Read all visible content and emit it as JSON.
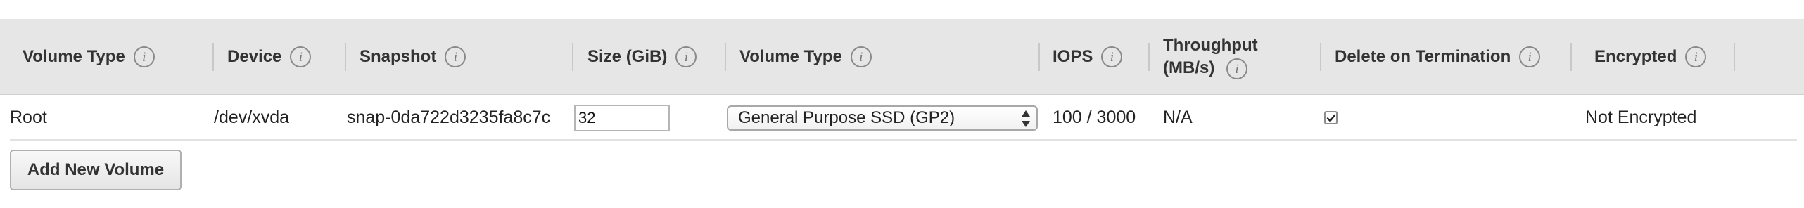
{
  "columns": [
    {
      "label": "Volume Type"
    },
    {
      "label": "Device"
    },
    {
      "label": "Snapshot"
    },
    {
      "label": "Size (GiB)"
    },
    {
      "label": "Volume Type"
    },
    {
      "label": "IOPS"
    },
    {
      "label": "Throughput (MB/s)"
    },
    {
      "label": "Delete on Termination"
    },
    {
      "label": "Encrypted"
    }
  ],
  "info_icon": {
    "glyph": "i",
    "name": "info-icon"
  },
  "row": {
    "volume_type": "Root",
    "device": "/dev/xvda",
    "snapshot": "snap-0da722d3235fa8c7c",
    "size_value": "32",
    "ebs_volume_type": "General Purpose SSD (GP2)",
    "iops": "100 / 3000",
    "throughput": "N/A",
    "delete_on_termination": true,
    "encrypted": "Not Encrypted"
  },
  "add_button_label": "Add New Volume",
  "colors": {
    "header_bg": "#e6e6e6",
    "row_border": "#e2e2e2",
    "text": "#222222"
  }
}
